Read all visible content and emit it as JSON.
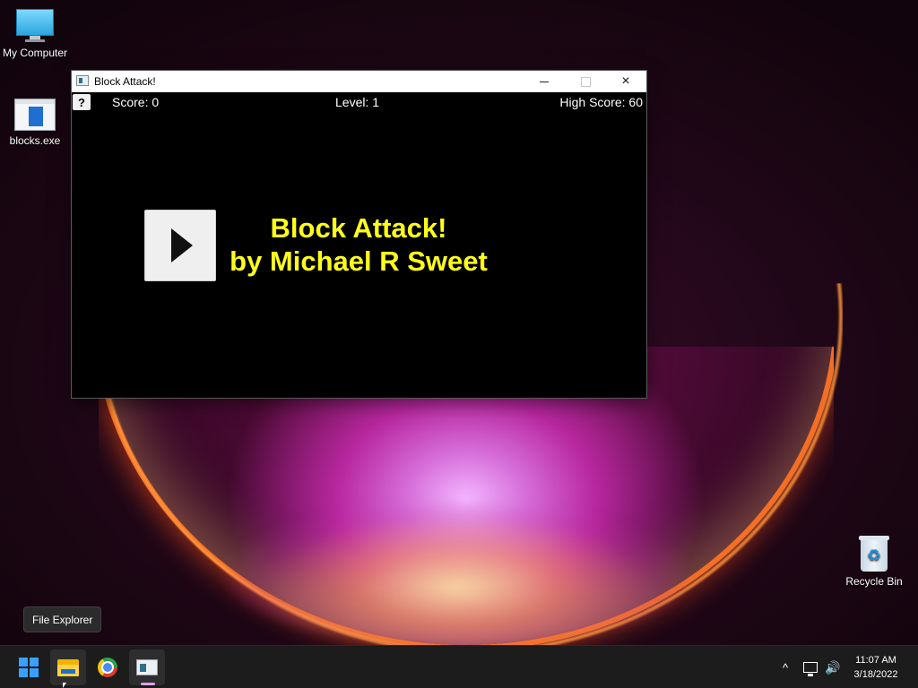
{
  "desktop": {
    "icons": [
      {
        "label": "My Computer",
        "icon": "computer-icon"
      },
      {
        "label": "blocks.exe",
        "icon": "exe-icon"
      },
      {
        "label": "Recycle Bin",
        "icon": "recycle-bin-icon"
      }
    ]
  },
  "window": {
    "title": "Block Attack!",
    "controls": {
      "minimize": "minimize-icon",
      "maximize": "maximize-icon",
      "close": "×"
    }
  },
  "game": {
    "help_label": "?",
    "score_text": "Score: 0",
    "level_text": "Level: 1",
    "high_score_text": "High Score: 60",
    "banner_line1": "Block Attack!",
    "banner_line2": "by Michael R Sweet",
    "banner_color": "#ffff1a",
    "play_icon": "play-icon"
  },
  "tooltip": {
    "text": "File Explorer"
  },
  "taskbar": {
    "items": [
      {
        "name": "Start",
        "icon": "windows-start-icon"
      },
      {
        "name": "File Explorer",
        "icon": "folder-icon"
      },
      {
        "name": "Google Chrome",
        "icon": "chrome-icon"
      },
      {
        "name": "Block Attack!",
        "icon": "blocks-app-icon",
        "running": true
      }
    ],
    "tray": {
      "chevron": "^",
      "network_icon": "network-icon",
      "volume_icon": "volume-icon",
      "volume_glyph": "🔊"
    },
    "clock": {
      "time": "11:07 AM",
      "date": "3/18/2022"
    }
  }
}
